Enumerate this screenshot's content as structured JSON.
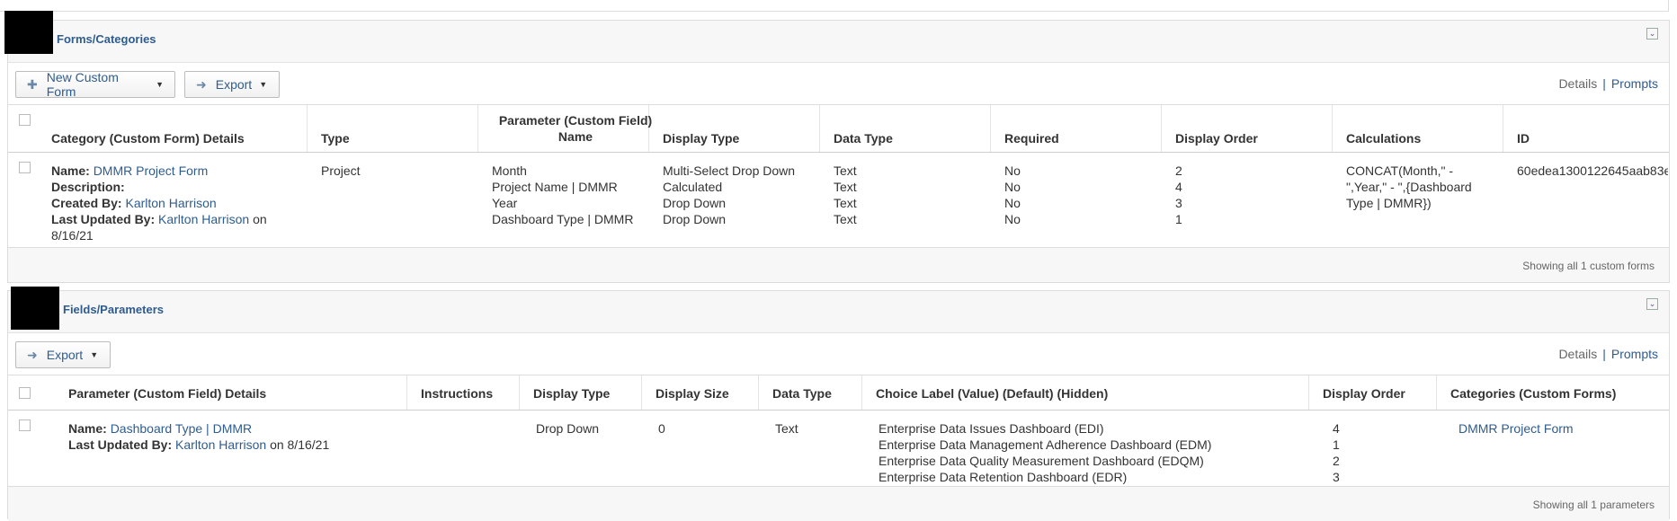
{
  "forms": {
    "title": "Forms/Categories",
    "toolbar": {
      "new_form_label": "New Custom Form",
      "export_label": "Export",
      "details_label": "Details",
      "prompts_label": "Prompts"
    },
    "columns": [
      "Category (Custom Form) Details",
      "Type",
      "Parameter (Custom Field) Name",
      "Display Type",
      "Data Type",
      "Required",
      "Display Order",
      "Calculations",
      "ID"
    ],
    "row": {
      "name_label": "Name:",
      "name_value": "DMMR Project Form",
      "description_label": "Description:",
      "created_by_label": "Created By:",
      "created_by_value": "Karlton Harrison",
      "updated_by_label": "Last Updated By:",
      "updated_by_value": "Karlton Harrison",
      "updated_on_text": "on",
      "updated_date": "8/16/21",
      "type": "Project",
      "parameters": [
        "Month",
        "Project Name | DMMR",
        "Year",
        "Dashboard Type | DMMR"
      ],
      "display_types": [
        "Multi-Select Drop Down",
        "Calculated",
        "Drop Down",
        "Drop Down"
      ],
      "data_types": [
        "Text",
        "Text",
        "Text",
        "Text"
      ],
      "required": [
        "No",
        "No",
        "No",
        "No"
      ],
      "display_orders": [
        "2",
        "4",
        "3",
        "1"
      ],
      "calculations": [
        "CONCAT(Month,\" -",
        "\",Year,\" - \",{Dashboard",
        "Type | DMMR})"
      ],
      "id": "60edea1300122645aab83e"
    },
    "footer": "Showing all 1 custom forms"
  },
  "fields": {
    "title": "Fields/Parameters",
    "toolbar": {
      "export_label": "Export",
      "details_label": "Details",
      "prompts_label": "Prompts"
    },
    "columns": [
      "Parameter (Custom Field) Details",
      "Instructions",
      "Display Type",
      "Display Size",
      "Data Type",
      "Choice Label (Value) (Default) (Hidden)",
      "Display Order",
      "Categories (Custom Forms)"
    ],
    "row": {
      "name_label": "Name:",
      "name_value": "Dashboard Type | DMMR",
      "updated_by_label": "Last Updated By:",
      "updated_by_value": "Karlton Harrison",
      "updated_on_text": "on 8/16/21",
      "display_type": "Drop Down",
      "display_size": "0",
      "data_type": "Text",
      "choices": [
        "Enterprise Data Issues Dashboard (EDI)",
        "Enterprise Data Management Adherence Dashboard (EDM)",
        "Enterprise Data Quality Measurement Dashboard (EDQM)",
        "Enterprise Data Retention Dashboard (EDR)"
      ],
      "display_orders": [
        "4",
        "1",
        "2",
        "3"
      ],
      "category": "DMMR Project Form"
    },
    "footer": "Showing all 1 parameters"
  }
}
